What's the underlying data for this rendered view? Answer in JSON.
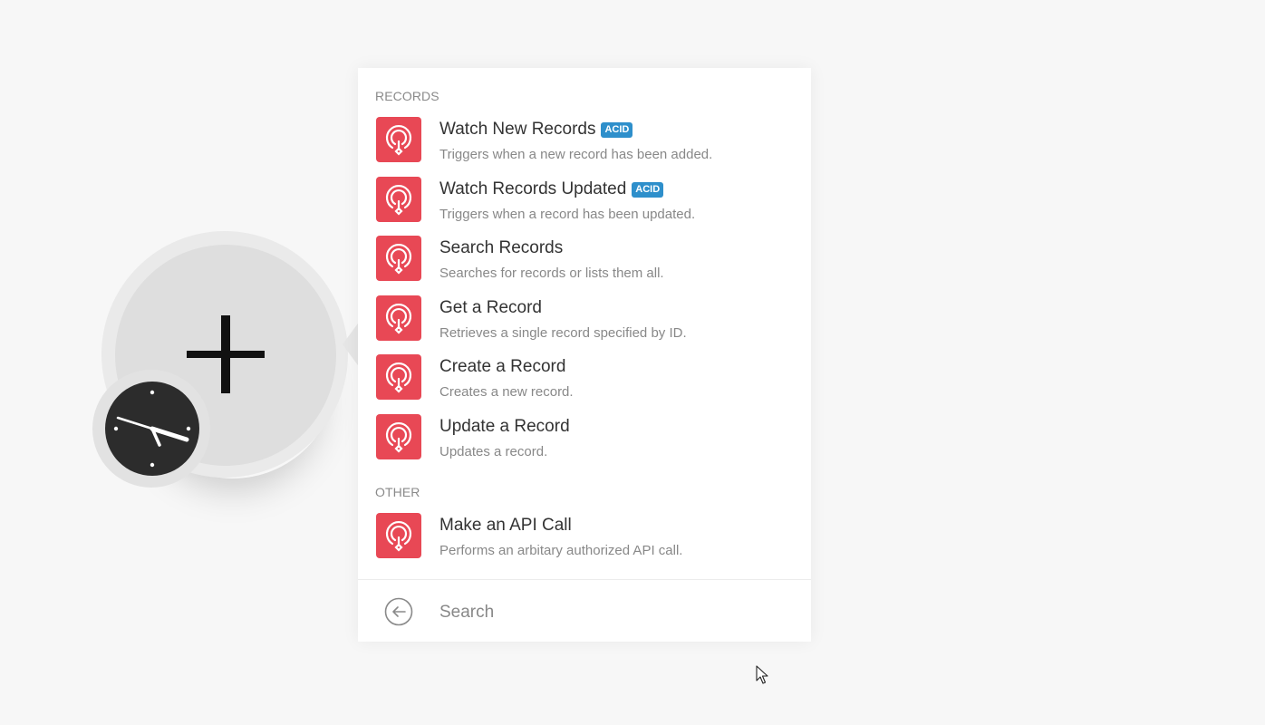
{
  "sections": [
    {
      "label": "RECORDS",
      "items": [
        {
          "title": "Watch New Records",
          "badge": "ACID",
          "desc": "Triggers when a new record has been added."
        },
        {
          "title": "Watch Records Updated",
          "badge": "ACID",
          "desc": "Triggers when a record has been updated."
        },
        {
          "title": "Search Records",
          "badge": "",
          "desc": "Searches for records or lists them all."
        },
        {
          "title": "Get a Record",
          "badge": "",
          "desc": "Retrieves a single record specified by ID."
        },
        {
          "title": "Create a Record",
          "badge": "",
          "desc": "Creates a new record."
        },
        {
          "title": "Update a Record",
          "badge": "",
          "desc": "Updates a record."
        }
      ]
    },
    {
      "label": "OTHER",
      "items": [
        {
          "title": "Make an API Call",
          "badge": "",
          "desc": "Performs an arbitary authorized API call."
        }
      ]
    }
  ],
  "search": {
    "placeholder": "Search",
    "value": ""
  },
  "colors": {
    "app_logo": "#e84855",
    "badge": "#2e8fcb",
    "section_label": "#8a8a8a"
  },
  "icons": {
    "app": "app-logo-icon",
    "back": "back-arrow-icon",
    "module": "plus-icon",
    "schedule": "clock-icon"
  }
}
